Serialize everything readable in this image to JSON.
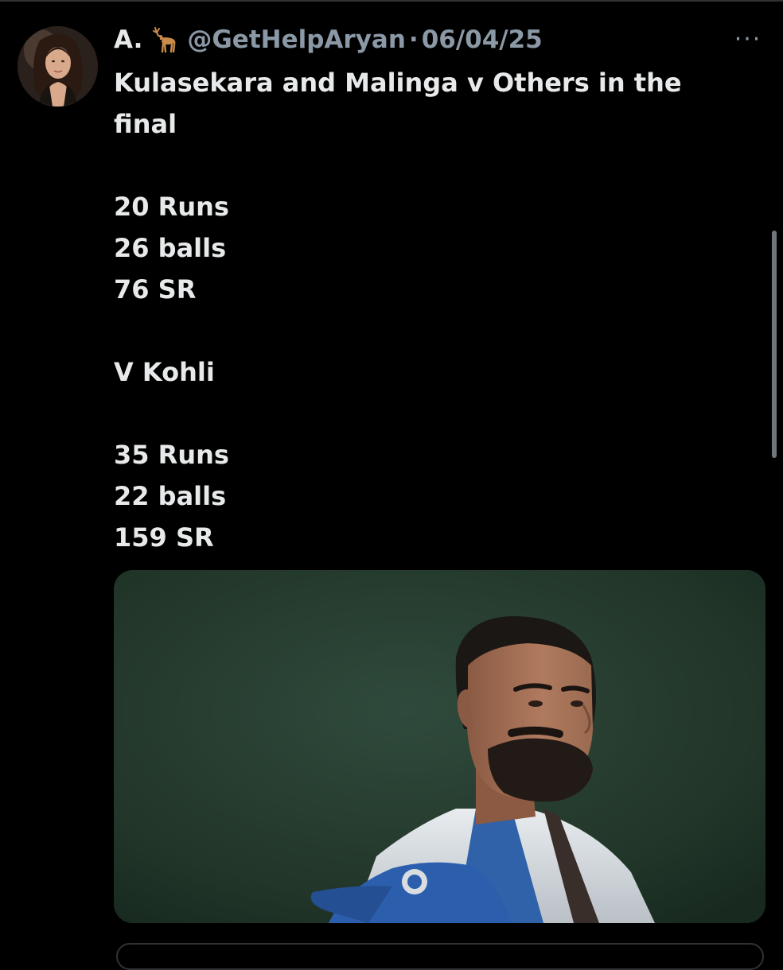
{
  "tweet": {
    "author": {
      "display_name": "A.",
      "name_emoji": "deer-emoji",
      "handle": "@GetHelpAryan",
      "separator": "·",
      "date": "06/04/25",
      "avatar": "profile-photo"
    },
    "more_menu_label": "···",
    "text_lines": [
      "Kulasekara and Malinga v Others in the",
      "final",
      "",
      "20 Runs",
      "26 balls",
      "76 SR",
      "",
      "V Kohli",
      "",
      "35 Runs",
      "22 balls",
      "159 SR"
    ],
    "media": {
      "type": "video-still",
      "description_icon": "cricketer-photo"
    }
  },
  "colors": {
    "background": "#000000",
    "primary_text": "#e7e9ea",
    "secondary_text": "#8b98a5",
    "border": "#2f3336",
    "scrollbar": "#6e767d"
  }
}
